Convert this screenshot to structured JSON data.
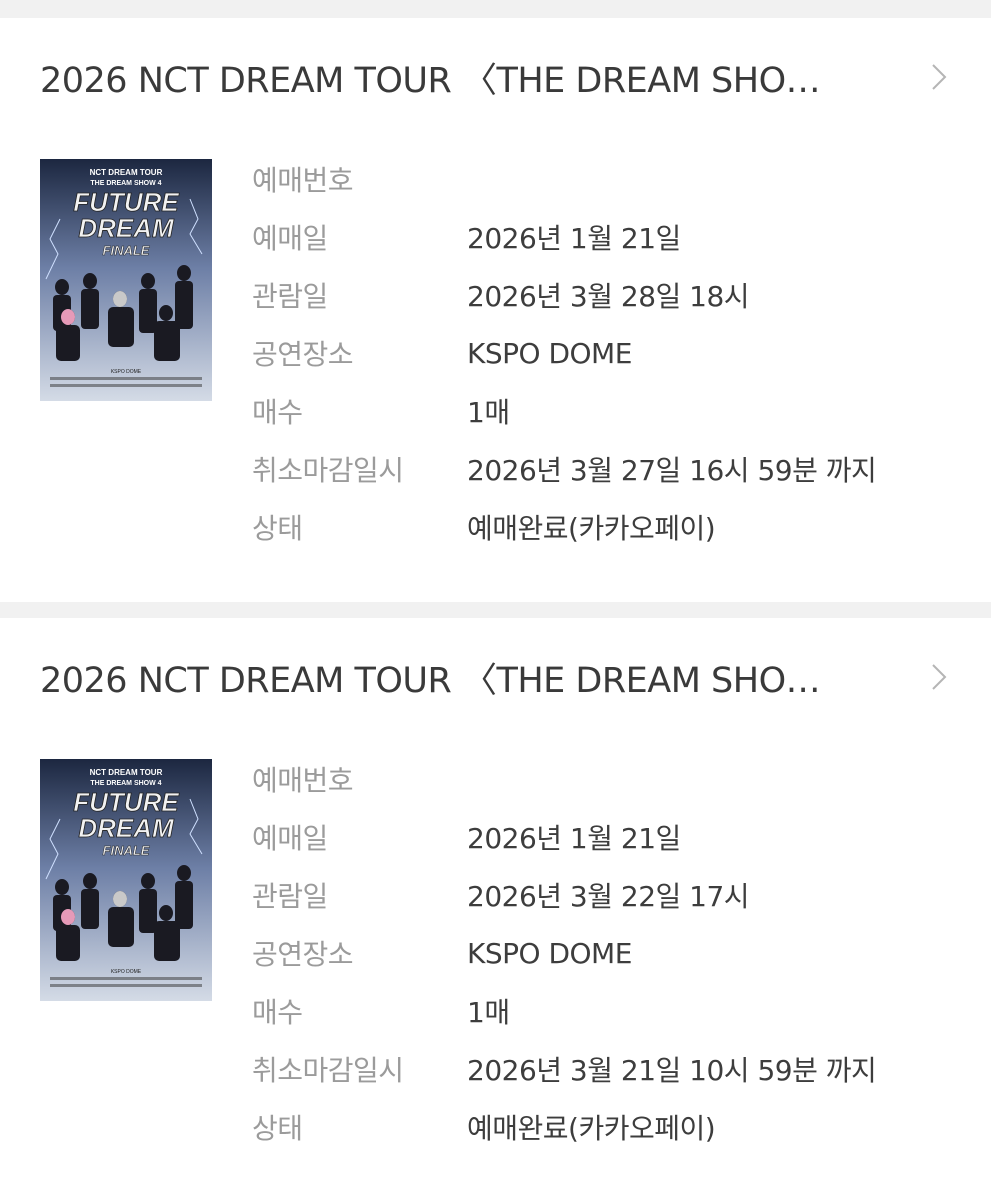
{
  "bookings": [
    {
      "title": "2026 NCT DREAM TOUR 〈THE DREAM SHO…",
      "poster": {
        "line1": "NCT DREAM TOUR",
        "line2": "THE DREAM SHOW 4",
        "logo1": "FUTURE",
        "logo2": "DREAM",
        "logo3": "FINALE",
        "venue": "KSPO DOME"
      },
      "labels": [
        "예매번호",
        "예매일",
        "관람일",
        "공연장소",
        "매수",
        "취소마감일시",
        "상태"
      ],
      "values": [
        "",
        "2026년 1월 21일",
        "2026년 3월 28일 18시",
        "KSPO DOME",
        "1매",
        "2026년 3월 27일 16시 59분 까지",
        "예매완료(카카오페이)"
      ]
    },
    {
      "title": "2026 NCT DREAM TOUR 〈THE DREAM SHO…",
      "poster": {
        "line1": "NCT DREAM TOUR",
        "line2": "THE DREAM SHOW 4",
        "logo1": "FUTURE",
        "logo2": "DREAM",
        "logo3": "FINALE",
        "venue": "KSPO DOME"
      },
      "labels": [
        "예매번호",
        "예매일",
        "관람일",
        "공연장소",
        "매수",
        "취소마감일시",
        "상태"
      ],
      "values": [
        "",
        "2026년 1월 21일",
        "2026년 3월 22일 17시",
        "KSPO DOME",
        "1매",
        "2026년 3월 21일 10시 59분 까지",
        "예매완료(카카오페이)"
      ]
    }
  ],
  "colors": {
    "background": "#f1f1f1",
    "card": "#ffffff",
    "label": "#9b9b9b",
    "value": "#3d3d3d",
    "poster_bg": "#a9b7cc"
  },
  "icons": {
    "chevron": "chevron-right-icon"
  }
}
